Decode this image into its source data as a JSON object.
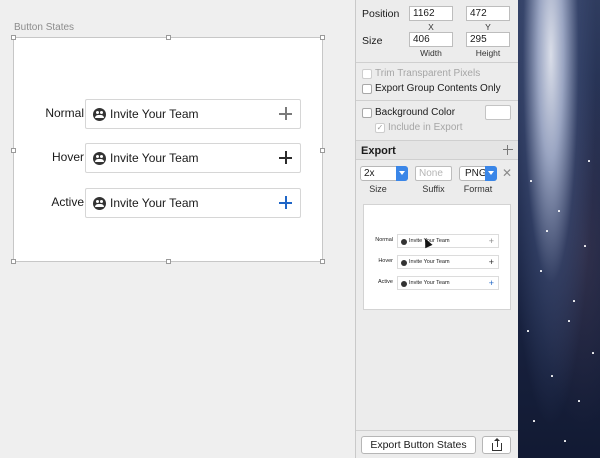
{
  "canvas": {
    "artboard_label": "Button States",
    "states": [
      {
        "label": "Normal",
        "button_text": "Invite Your Team",
        "plus_color": "#7a7a7a"
      },
      {
        "label": "Hover",
        "button_text": "Invite Your Team",
        "plus_color": "#2b2b2b"
      },
      {
        "label": "Active",
        "button_text": "Invite Your Team",
        "plus_color": "#1f66c7"
      }
    ]
  },
  "inspector": {
    "position": {
      "label": "Position",
      "x": "1162",
      "y": "472",
      "x_label": "X",
      "y_label": "Y"
    },
    "size": {
      "label": "Size",
      "width": "406",
      "height": "295",
      "width_label": "Width",
      "height_label": "Height"
    },
    "options": {
      "trim": "Trim Transparent Pixels",
      "export_group": "Export Group Contents Only",
      "background_color": "Background Color",
      "include_in_export": "Include in Export"
    },
    "export": {
      "title": "Export",
      "scale": "2x",
      "suffix_placeholder": "None",
      "format": "PNG",
      "size_label": "Size",
      "suffix_label": "Suffix",
      "format_label": "Format"
    },
    "export_button": "Export Button States"
  },
  "colors": {
    "accent": "#3a86e8",
    "active_plus": "#1f66c7"
  }
}
